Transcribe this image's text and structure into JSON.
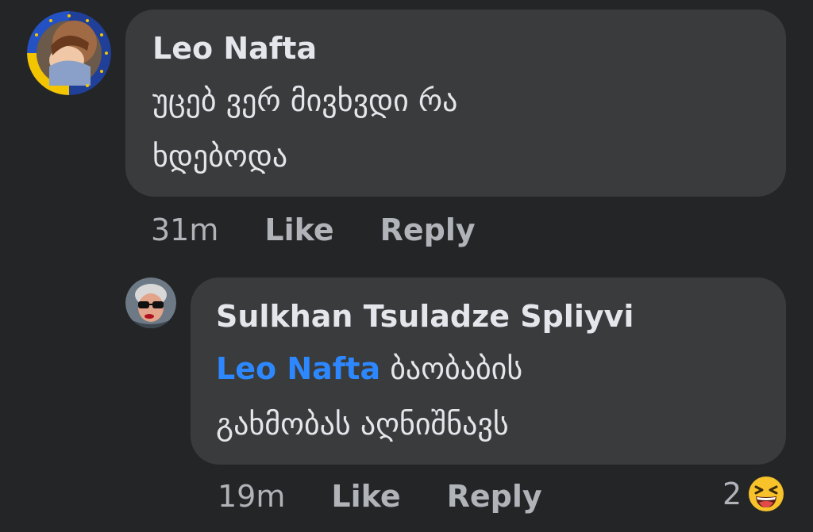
{
  "comments": [
    {
      "author": "Leo Nafta",
      "text_line1": "უცებ ვერ მივხვდი რა",
      "text_line2": "ხდებოდა",
      "time": "31m",
      "like_label": "Like",
      "reply_label": "Reply"
    },
    {
      "author": "Sulkhan Tsuladze Spliyvi",
      "mention": "Leo Nafta",
      "text_line1": " ბაობაბის",
      "text_line2": "გახმობას აღნიშნავს",
      "time": "19m",
      "like_label": "Like",
      "reply_label": "Reply",
      "reaction_count": "2",
      "reaction_icon": "laughing-emoji-icon"
    }
  ],
  "colors": {
    "background": "#242527",
    "bubble": "#3a3b3c",
    "text": "#e4e6eb",
    "secondary": "#b0b3b8",
    "mention": "#2d88ff"
  }
}
